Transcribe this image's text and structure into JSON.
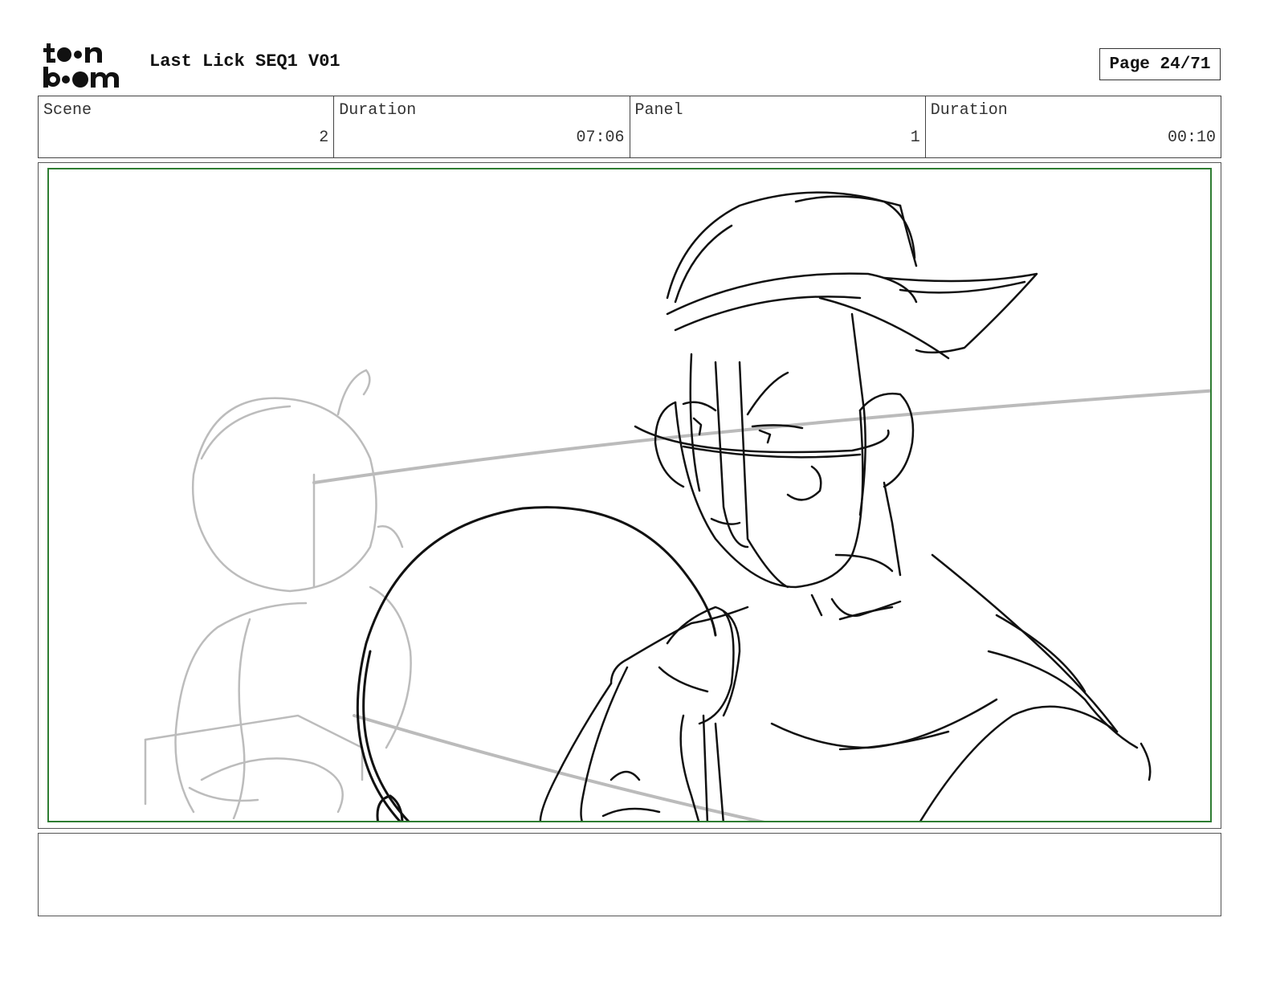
{
  "header": {
    "logo_text": "toonboom",
    "title": "Last Lick SEQ1 V01",
    "page_label": "Page 24/71"
  },
  "info": [
    {
      "label": "Scene",
      "value": "2"
    },
    {
      "label": "Duration",
      "value": "07:06"
    },
    {
      "label": "Panel",
      "value": "1"
    },
    {
      "label": "Duration",
      "value": "00:10"
    }
  ],
  "panel": {
    "frame_color": "#2e7d32",
    "description": ""
  },
  "notes": {
    "text": ""
  }
}
